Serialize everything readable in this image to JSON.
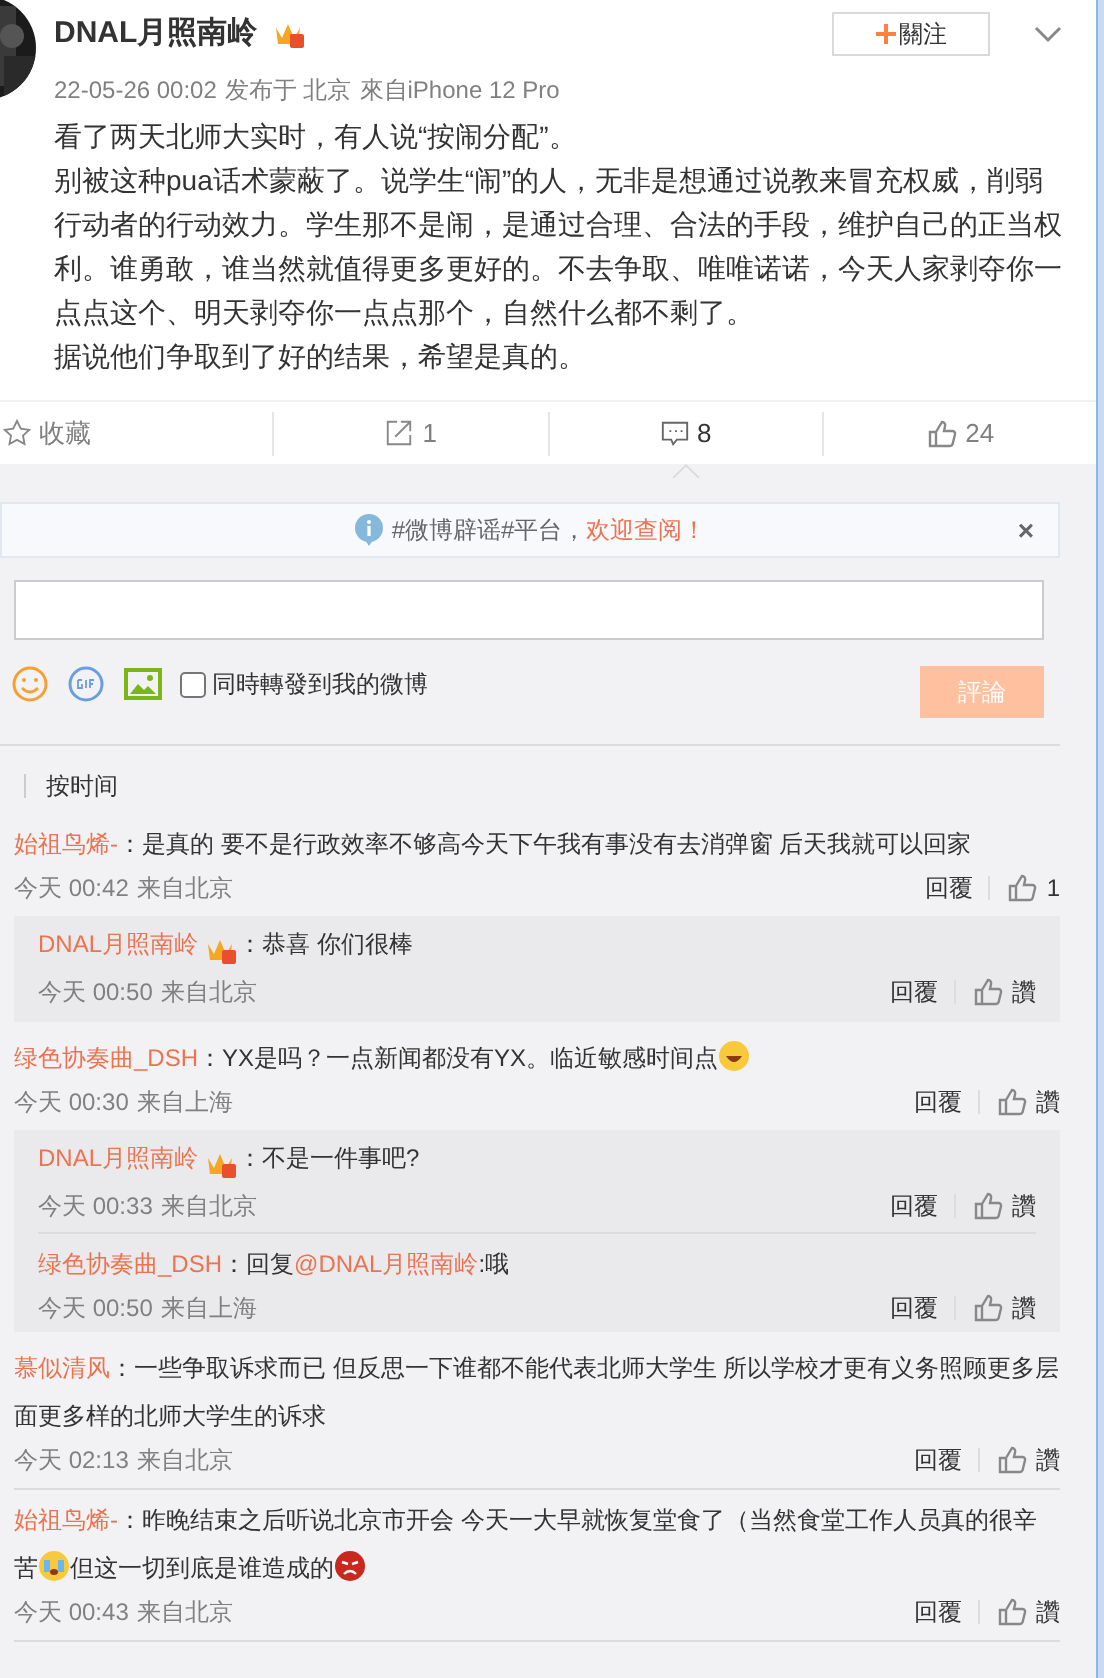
{
  "post": {
    "author": "DNAL月照南岭",
    "vip": true,
    "follow_label": "關注",
    "time": "22-05-26 00:02",
    "location": "发布于 北京",
    "source": "來自iPhone 12 Pro",
    "paragraphs": [
      "看了两天北师大实时，有人说“按闹分配”。",
      "别被这种pua话术蒙蔽了。说学生“闹”的人，无非是想通过说教来冒充权威，削弱行动者的行动效力。学生那不是闹，是通过合理、合法的手段，维护自己的正当权利。谁勇敢，谁当然就值得更多更好的。不去争取、唯唯诺诺，今天人家剥夺你一点点这个、明天剥夺你一点点那个，自然什么都不剩了。",
      "据说他们争取到了好的结果，希望是真的。"
    ]
  },
  "actions": [
    {
      "kind": "favorite",
      "label": "收藏",
      "selected": false
    },
    {
      "kind": "repost",
      "label": "1",
      "selected": false
    },
    {
      "kind": "comment",
      "label": "8",
      "selected": true
    },
    {
      "kind": "like",
      "label": "24",
      "selected": false
    }
  ],
  "notice": {
    "text": "#微博辟谣#平台，",
    "link": "欢迎查阅！",
    "close": "×"
  },
  "composer": {
    "repost_label": "同時轉發到我的微博",
    "repost_checked": false,
    "submit_label": "評論",
    "submit_disabled": true
  },
  "sort": {
    "label": "按时间"
  },
  "comments": [
    {
      "user": "始祖鸟烯-",
      "vip": false,
      "content": [
        {
          "kind": "text",
          "text": "：是真的 要不是行政效率不够高今天下午我有事没有去消弹窗 后天我就可以回家"
        }
      ],
      "time": "今天 00:42",
      "source": "来自北京",
      "reply_label": "回覆",
      "like_label": "1",
      "replies": [
        {
          "user": "DNAL月照南岭",
          "vip": true,
          "content": [
            {
              "kind": "text",
              "text": "：恭喜 你们很棒"
            }
          ],
          "time": "今天 00:50",
          "source": "来自北京",
          "reply_label": "回覆",
          "like_label": "讚"
        }
      ]
    },
    {
      "user": "绿色协奏曲_DSH",
      "vip": false,
      "content": [
        {
          "kind": "text",
          "text": "：YX是吗？一点新闻都没有YX。临近敏感时间点"
        },
        {
          "kind": "laughing"
        }
      ],
      "time": "今天 00:30",
      "source": "来自上海",
      "reply_label": "回覆",
      "like_label": "讚",
      "replies": [
        {
          "user": "DNAL月照南岭",
          "vip": true,
          "content": [
            {
              "kind": "text",
              "text": "：不是一件事吧?"
            }
          ],
          "time": "今天 00:33",
          "source": "来自北京",
          "reply_label": "回覆",
          "like_label": "讚"
        },
        {
          "user": "绿色协奏曲_DSH",
          "vip": false,
          "content": [
            {
              "kind": "text",
              "text": "：回复"
            },
            {
              "kind": "mention",
              "text": "@DNAL月照南岭"
            },
            {
              "kind": "text",
              "text": ":哦"
            }
          ],
          "time": "今天 00:50",
          "source": "来自上海",
          "reply_label": "回覆",
          "like_label": "讚"
        }
      ]
    },
    {
      "user": "慕似清风",
      "vip": false,
      "content": [
        {
          "kind": "text",
          "text": "：一些争取诉求而已 但反思一下谁都不能代表北师大学生 所以学校才更有义务照顾更多层面更多样的北师大学生的诉求"
        }
      ],
      "time": "今天 02:13",
      "source": "来自北京",
      "reply_label": "回覆",
      "like_label": "讚"
    },
    {
      "user": "始祖鸟烯-",
      "vip": false,
      "content": [
        {
          "kind": "text",
          "text": "：昨晚结束之后听说北京市开会 今天一大早就恢复堂食了（当然食堂工作人员真的很辛苦"
        },
        {
          "kind": "crying"
        },
        {
          "kind": "text",
          "text": "但这一切到底是谁造成的"
        },
        {
          "kind": "angry"
        }
      ],
      "time": "今天 00:43",
      "source": "来自北京",
      "reply_label": "回覆",
      "like_label": "讚"
    }
  ]
}
